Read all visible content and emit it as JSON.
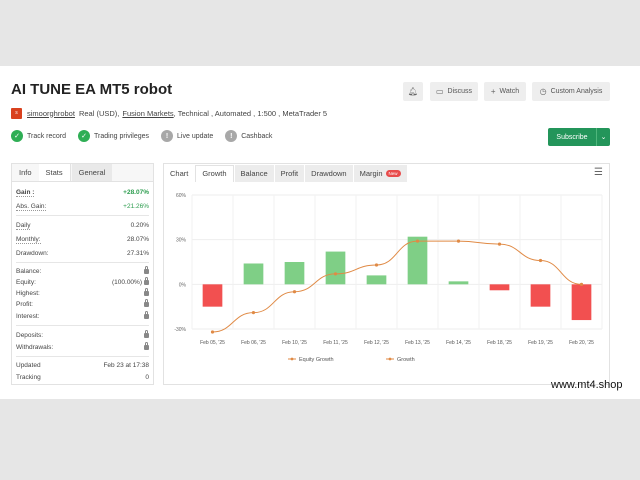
{
  "title": "AI TUNE EA MT5 robot",
  "actions": {
    "notify_icon": "bell-icon",
    "discuss": "Discuss",
    "watch": "Watch",
    "analysis": "Custom Analysis"
  },
  "meta": {
    "logo_letter": "s",
    "author": "simoorghrobot",
    "account": "Real (USD),",
    "broker": "Fusion Markets",
    "details": ", Technical , Automated , 1:500 , MetaTrader 5"
  },
  "badges": [
    {
      "label": "Track record",
      "mark": "✓"
    },
    {
      "label": "Trading privileges",
      "mark": "✓"
    },
    {
      "label": "Live update",
      "mark": "!"
    },
    {
      "label": "Cashback",
      "mark": "!"
    }
  ],
  "subscribe": "Subscribe",
  "left_tabs": [
    "Info",
    "Stats",
    "General"
  ],
  "stats": {
    "gain": {
      "k": "Gain :",
      "v": "+28.07%"
    },
    "abs_gain": {
      "k": "Abs. Gain:",
      "v": "+21.26%"
    },
    "daily": {
      "k": "Daily",
      "v": "0.20%"
    },
    "monthly": {
      "k": "Monthly:",
      "v": "28.07%"
    },
    "drawdown": {
      "k": "Drawdown:",
      "v": "27.31%"
    },
    "balance": {
      "k": "Balance:"
    },
    "equity": {
      "k": "Equity:",
      "v": "(100.00%)"
    },
    "highest": {
      "k": "Highest:"
    },
    "profit": {
      "k": "Profit:"
    },
    "interest": {
      "k": "Interest:"
    },
    "deposits": {
      "k": "Deposits:"
    },
    "withdrawals": {
      "k": "Withdrawals:"
    },
    "updated": {
      "k": "Updated",
      "v": "Feb 23 at 17:38"
    },
    "tracking": {
      "k": "Tracking",
      "v": "0"
    }
  },
  "right_tabs": {
    "chart": "Chart",
    "growth": "Growth",
    "balance": "Balance",
    "profit": "Profit",
    "drawdown": "Drawdown",
    "margin": "Margin",
    "new": "New"
  },
  "colors": {
    "bar_pos": "#7fcf86",
    "bar_neg": "#f25050",
    "line": "#e08a45",
    "primary_green": "#23955a"
  },
  "chart_data": {
    "type": "bar",
    "categories": [
      "Feb 05, '25",
      "Feb 06, '25",
      "Feb 10, '25",
      "Feb 11, '25",
      "Feb 12, '25",
      "Feb 13, '25",
      "Feb 14, '25",
      "Feb 18, '25",
      "Feb 19, '25",
      "Feb 20, '25"
    ],
    "series": [
      {
        "name": "Growth",
        "type": "bar",
        "values": [
          -15,
          14,
          15,
          22,
          6,
          32,
          2,
          -4,
          -15,
          -24
        ]
      },
      {
        "name": "Equity Growth",
        "type": "line",
        "values": [
          -32,
          -19,
          -5,
          7,
          13,
          29,
          29,
          27,
          16,
          0
        ]
      }
    ],
    "ylim": [
      -30,
      60
    ],
    "yticks": [
      -30,
      0,
      30,
      60
    ],
    "ytick_labels": [
      "-30%",
      "0%",
      "30%",
      "60%"
    ],
    "grid": true,
    "legend": "bottom"
  },
  "watermark": "www.mt4.shop"
}
